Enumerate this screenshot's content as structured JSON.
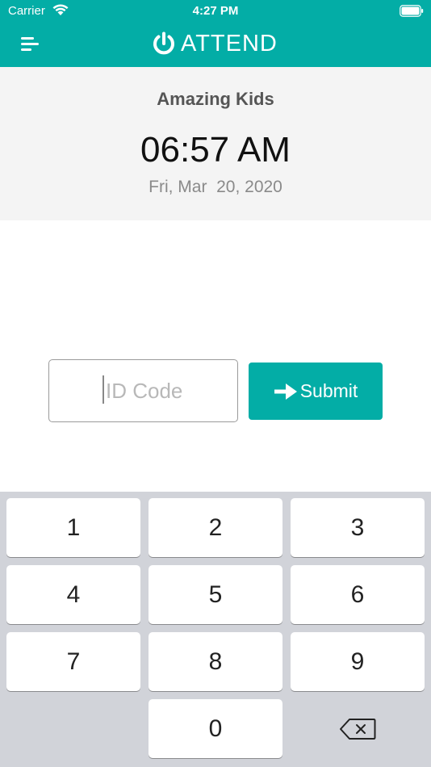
{
  "status_bar": {
    "carrier": "Carrier",
    "time": "4:27 PM",
    "icons": [
      "wifi-icon",
      "battery-icon"
    ]
  },
  "nav": {
    "menu_icon": "menu-icon",
    "logo_icon": "power-icon",
    "brand": "ATTEND"
  },
  "info": {
    "org_name": "Amazing Kids",
    "clock": "06:57 AM",
    "date": "Fri, Mar  20, 2020"
  },
  "form": {
    "id_placeholder": "ID Code",
    "id_value": "",
    "submit_icon": "arrow-right-icon",
    "submit_label": "Submit"
  },
  "keypad": {
    "keys": [
      "1",
      "2",
      "3",
      "4",
      "5",
      "6",
      "7",
      "8",
      "9",
      "0"
    ],
    "backspace_icon": "backspace-icon"
  },
  "colors": {
    "accent": "#03ADA6",
    "info_background": "#F4F4F4",
    "keypad_background": "#D1D3D9"
  }
}
